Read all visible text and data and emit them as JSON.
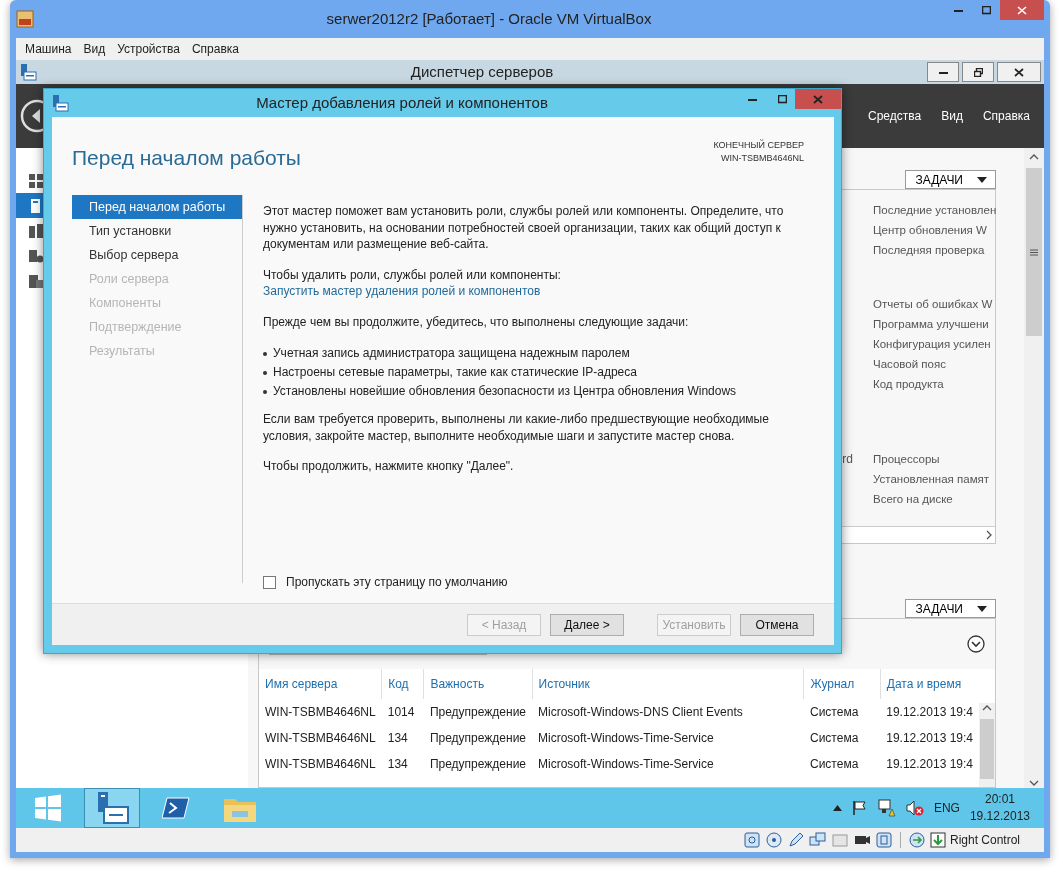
{
  "vbox": {
    "title": "serwer2012r2 [Работает] - Oracle VM VirtualBox",
    "menu": [
      "Машина",
      "Вид",
      "Устройства",
      "Справка"
    ],
    "status_text": "Right Control"
  },
  "server_manager": {
    "title": "Диспетчер серверов",
    "header_menu": [
      "Средства",
      "Вид",
      "Справка"
    ],
    "nav": [
      {
        "selected": false
      },
      {
        "selected": true
      },
      {
        "selected": false
      },
      {
        "selected": false
      },
      {
        "selected": false
      }
    ],
    "upper_tile": {
      "tasks": "ЗАДАЧИ",
      "groups": [
        {
          "items": [
            "Последние установлен",
            "Центр обновления W",
            "Последняя проверка"
          ]
        },
        {
          "items": [
            "Отчеты об ошибках W",
            "Программа улучшени",
            "Конфигурация усилен",
            "Часовой пояс",
            "Код продукта"
          ]
        },
        {
          "fragment": "rd",
          "items": [
            "Процессоры",
            "Установленная памят",
            "Всего на диске"
          ]
        }
      ]
    },
    "lower_tile": {
      "tasks": "ЗАДАЧИ",
      "columns": [
        "Имя сервера",
        "Код",
        "Важность",
        "Источник",
        "Журнал",
        "Дата и время"
      ],
      "rows": [
        [
          "WIN-TSBMB4646NL",
          "1014",
          "Предупреждение",
          "Microsoft-Windows-DNS Client Events",
          "Система",
          "19.12.2013 19:4"
        ],
        [
          "WIN-TSBMB4646NL",
          "134",
          "Предупреждение",
          "Microsoft-Windows-Time-Service",
          "Система",
          "19.12.2013 19:4"
        ],
        [
          "WIN-TSBMB4646NL",
          "134",
          "Предупреждение",
          "Microsoft-Windows-Time-Service",
          "Система",
          "19.12.2013 19:4"
        ]
      ]
    }
  },
  "wizard": {
    "title": "Мастер добавления ролей и компонентов",
    "heading": "Перед началом работы",
    "target_label": "КОНЕЧНЫЙ СЕРВЕР",
    "target_server": "WIN-TSBMB4646NL",
    "steps": [
      {
        "label": "Перед началом работы",
        "selected": true,
        "disabled": false
      },
      {
        "label": "Тип установки",
        "selected": false,
        "disabled": false
      },
      {
        "label": "Выбор сервера",
        "selected": false,
        "disabled": false
      },
      {
        "label": "Роли сервера",
        "selected": false,
        "disabled": true
      },
      {
        "label": "Компоненты",
        "selected": false,
        "disabled": true
      },
      {
        "label": "Подтверждение",
        "selected": false,
        "disabled": true
      },
      {
        "label": "Результаты",
        "selected": false,
        "disabled": true
      }
    ],
    "content": [
      {
        "kind": "text",
        "text": "Этот мастер поможет вам установить роли, службы ролей или компоненты. Определите, что нужно установить, на основании потребностей своей организации, таких как общий доступ к документам или размещение веб-сайта."
      },
      {
        "kind": "link",
        "text": "Чтобы удалить роли, службы ролей или компоненты:",
        "link": "Запустить мастер удаления ролей и компонентов"
      },
      {
        "kind": "text",
        "text": "Прежде чем вы продолжите, убедитесь, что выполнены следующие задачи:"
      },
      {
        "kind": "bullets",
        "items": [
          "Учетная запись администратора защищена надежным паролем",
          "Настроены сетевые параметры, такие как статические IP-адреса",
          "Установлены новейшие обновления безопасности из Центра обновления Windows"
        ]
      },
      {
        "kind": "text",
        "text": "Если вам требуется проверить, выполнены ли какие-либо предшествующие необходимые условия, закройте мастер, выполните необходимые шаги и запустите мастер снова."
      },
      {
        "kind": "text",
        "text": "Чтобы продолжить, нажмите кнопку \"Далее\"."
      }
    ],
    "skip_checkbox": {
      "label": "Пропускать эту страницу по умолчанию",
      "checked": false
    },
    "buttons": [
      {
        "label": "< Назад",
        "disabled": true
      },
      {
        "label": "Далее >",
        "disabled": false
      },
      {
        "label": "Установить",
        "disabled": true
      },
      {
        "label": "Отмена",
        "disabled": false
      }
    ]
  },
  "taskbar": {
    "apps": [
      {
        "kind": "start",
        "selected": false
      },
      {
        "kind": "server-manager",
        "selected": true
      },
      {
        "kind": "powershell",
        "selected": false
      },
      {
        "kind": "explorer",
        "selected": false
      }
    ],
    "language": "ENG",
    "time": "20:01",
    "date": "19.12.2013"
  }
}
